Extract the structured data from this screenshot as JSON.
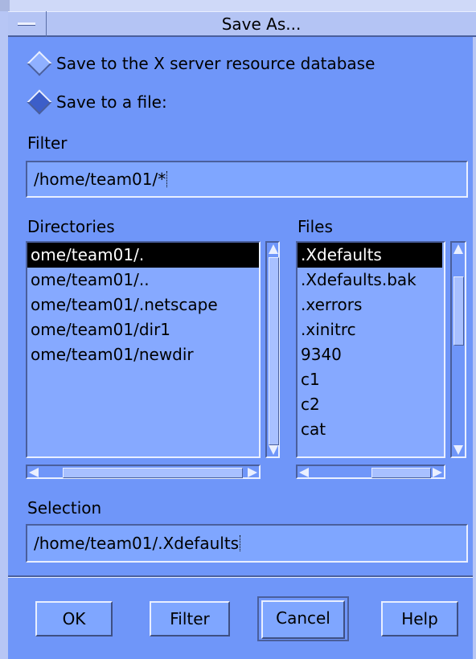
{
  "window": {
    "title": "Save As..."
  },
  "options": {
    "resource_db_label": "Save to the X server resource database",
    "file_label": "Save to a file:"
  },
  "filter": {
    "label": "Filter",
    "value": "/home/team01/*"
  },
  "directories": {
    "label": "Directories",
    "items": [
      "ome/team01/.",
      "ome/team01/..",
      "ome/team01/.netscape",
      "ome/team01/dir1",
      "ome/team01/newdir"
    ]
  },
  "files": {
    "label": "Files",
    "items": [
      ".Xdefaults",
      ".Xdefaults.bak",
      ".xerrors",
      ".xinitrc",
      "9340",
      "c1",
      "c2",
      "cat"
    ]
  },
  "selection": {
    "label": "Selection",
    "value": "/home/team01/.Xdefaults"
  },
  "buttons": {
    "ok": "OK",
    "filter": "Filter",
    "cancel": "Cancel",
    "help": "Help"
  },
  "colors": {
    "panel": "#6f96f9",
    "title_bar": "#b4c4f4",
    "selected_bg": "#000000"
  }
}
